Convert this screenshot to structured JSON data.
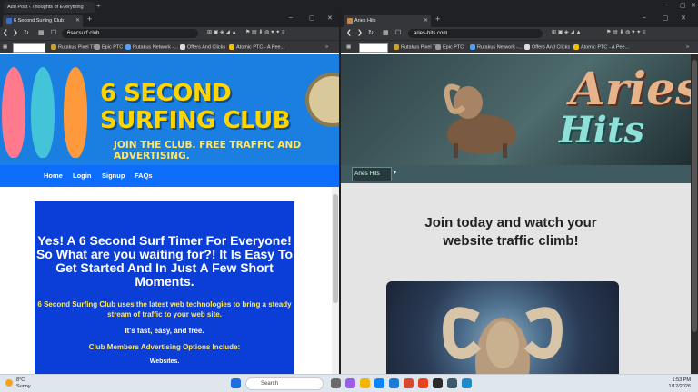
{
  "top_tab": {
    "title": "Add Post ‹ Thoughts of Everything"
  },
  "left": {
    "tab_title": "6 Second Surfing Club",
    "url": "6secsurf.club",
    "bookmarks": [
      "Rutakus Pixel TE",
      "Epic PTC",
      "Rutakus Network -...",
      "Offers And Clicks",
      "Atomic PTC - A Pee..."
    ],
    "header_title": "6 SECOND SURFING CLUB",
    "header_sub": "JOIN THE CLUB. FREE TRAFFIC AND ADVERTISING.",
    "nav": [
      "Home",
      "Login",
      "Signup",
      "FAQs"
    ],
    "headline": "Yes! A 6 Second Surf Timer For Everyone! So What are you waiting for?! It Is Easy To Get Started And In Just A Few Short Moments.",
    "yellow_text": "6 Second Surfing Club uses the latest web technologies to bring a steady stream of traffic to your web site.",
    "fast_text": "It's fast, easy, and free.",
    "options_title": "Club Members Advertising Options Include:",
    "option_1": "Websites."
  },
  "right": {
    "tab_title": "Aries Hits",
    "url": "aries-hits.com",
    "bookmarks": [
      "Rutakus Pixel TE",
      "Epic PTC",
      "Rutakus Network -...",
      "Offers And Clicks",
      "Atomic PTC - A Pee..."
    ],
    "logo_line1": "Aries",
    "logo_line2": "Hits",
    "menu_label": "Aries Hits",
    "headline_1": "Join today and watch your",
    "headline_2": "website traffic climb!"
  },
  "taskbar": {
    "temp": "8°C",
    "condition": "Sunny",
    "search_placeholder": "Search",
    "time": "1:53 PM",
    "date": "1/12/2026"
  },
  "colors": {
    "ssc_blue": "#1a7fe0",
    "ssc_yellow": "#ffd500",
    "bluebox": "#0a3ed6",
    "aries_copper": "#e6b38a",
    "aries_teal": "#8ee0d8"
  }
}
